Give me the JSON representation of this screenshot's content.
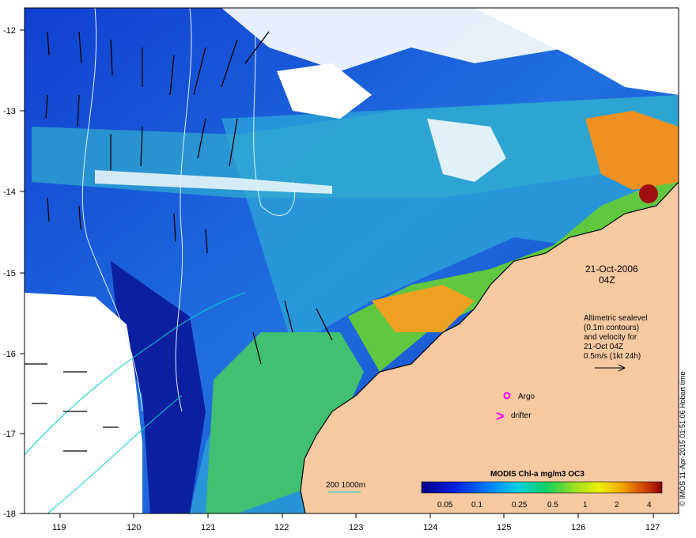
{
  "map": {
    "lon_ticks": [
      "119",
      "120",
      "121",
      "122",
      "123",
      "124",
      "125",
      "126",
      "127"
    ],
    "lat_ticks": [
      "-12",
      "-13",
      "-14",
      "-15",
      "-16",
      "-17",
      "-18"
    ],
    "date": "21-Oct-2006",
    "time": "04Z",
    "desc_lines": [
      "Altimetric sealevel",
      "(0.1m contours)",
      "and velocity for",
      "21-Oct 04Z",
      "0.5m/s (1kt 24h)"
    ],
    "argo_label": "Argo",
    "drifter_label": "drifter",
    "isobath_label": "200  1000m",
    "colorbar_title": "MODIS Chl-a mg/m3 OC3",
    "colorbar_ticks": [
      "0.05",
      "0.1",
      "0.25",
      "0.5",
      "1",
      "2",
      "4"
    ],
    "credit": "© IMOS 11-Apr-2015 01:51:06 Hobart time",
    "colors": {
      "land": "#f7c9a1",
      "argo": "#ff00ff",
      "drifter": "#ff00ff",
      "isobath": "#00d0d0"
    }
  }
}
